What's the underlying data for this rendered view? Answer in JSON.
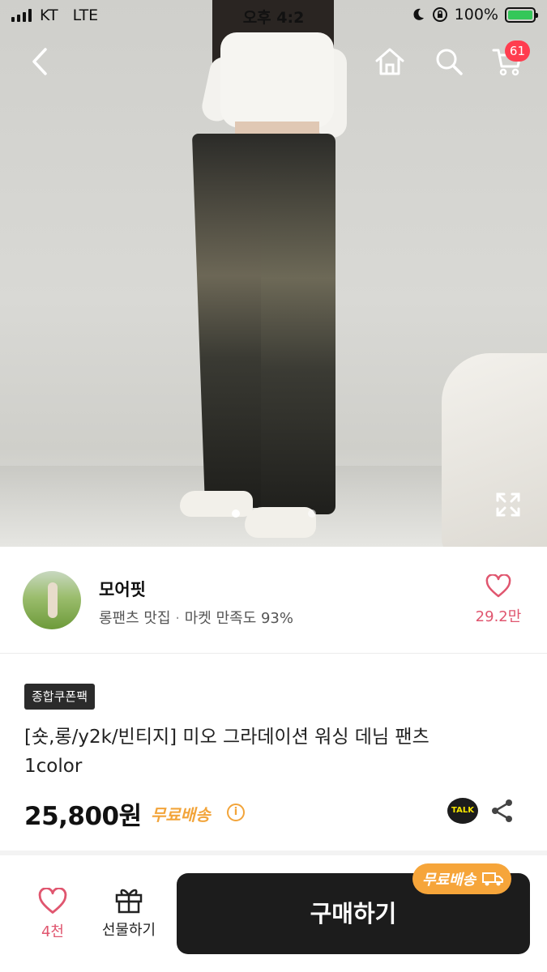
{
  "status_bar": {
    "carrier": "KT",
    "network": "LTE",
    "time": "오후 4:2",
    "battery": "100%"
  },
  "icons": {
    "back": "back-chevron-icon",
    "home": "home-icon",
    "search": "search-icon",
    "cart": "cart-icon",
    "expand": "expand-icon",
    "heart": "heart-icon",
    "gift": "gift-icon",
    "talk": "kakao-talk-icon",
    "share": "share-icon",
    "truck": "truck-icon"
  },
  "header": {
    "cart_count": "61"
  },
  "gallery": {
    "slide_count": 2,
    "active_index": 0
  },
  "seller": {
    "name": "모어핏",
    "category": "롱팬츠 맛집",
    "separator": "·",
    "satisfaction": "마켓 만족도 93%",
    "likes": "29.2만"
  },
  "product": {
    "coupon_tag": "종합쿠폰팩",
    "title_line1": "[숏,롱/y2k/빈티지] 미오 그라데이션 워싱 데님 팬츠",
    "title_line2": "1color",
    "price": "25,800원",
    "shipping": "무료배송",
    "talk_label": "TALK"
  },
  "bottom_bar": {
    "like_count": "4천",
    "gift_label": "선물하기",
    "buy_label": "구매하기",
    "free_shipping_badge": "무료배송"
  },
  "colors": {
    "accent_pink": "#e0566f",
    "shipping_orange": "#f2a43a",
    "badge_red": "#ff3d4f",
    "buy_button": "#1c1c1c"
  }
}
